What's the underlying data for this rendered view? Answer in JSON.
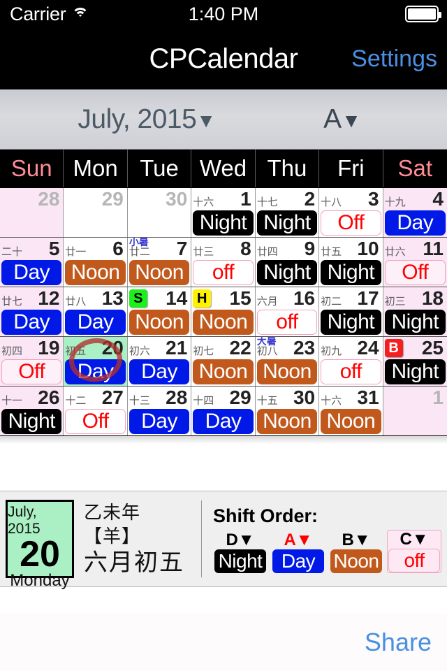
{
  "statusbar": {
    "carrier": "Carrier",
    "time": "1:40 PM",
    "wifi_icon": "wifi-icon",
    "battery_icon": "battery-full-icon"
  },
  "navbar": {
    "title": "CPCalendar",
    "settings": "Settings"
  },
  "toolbar": {
    "month": "July, 2015",
    "month_caret": "▼",
    "font_size": "A",
    "font_caret": "▼"
  },
  "weekdays": [
    {
      "label": "Sun",
      "weekend": true
    },
    {
      "label": "Mon",
      "weekend": false
    },
    {
      "label": "Tue",
      "weekend": false
    },
    {
      "label": "Wed",
      "weekend": false
    },
    {
      "label": "Thu",
      "weekend": false
    },
    {
      "label": "Fri",
      "weekend": false
    },
    {
      "label": "Sat",
      "weekend": true
    }
  ],
  "weeks": [
    [
      {
        "day": "28",
        "lunar": "",
        "term": "",
        "badge": "",
        "shift": "",
        "shift_class": "empty",
        "other": true,
        "weekend": true,
        "selected": false
      },
      {
        "day": "29",
        "lunar": "",
        "term": "",
        "badge": "",
        "shift": "",
        "shift_class": "empty",
        "other": true,
        "weekend": false,
        "selected": false
      },
      {
        "day": "30",
        "lunar": "",
        "term": "",
        "badge": "",
        "shift": "",
        "shift_class": "empty",
        "other": true,
        "weekend": false,
        "selected": false
      },
      {
        "day": "1",
        "lunar": "十六",
        "term": "",
        "badge": "",
        "shift": "Night",
        "shift_class": "night",
        "other": false,
        "weekend": false,
        "selected": false
      },
      {
        "day": "2",
        "lunar": "十七",
        "term": "",
        "badge": "",
        "shift": "Night",
        "shift_class": "night",
        "other": false,
        "weekend": false,
        "selected": false
      },
      {
        "day": "3",
        "lunar": "十八",
        "term": "",
        "badge": "",
        "shift": "Off",
        "shift_class": "off",
        "other": false,
        "weekend": false,
        "selected": false
      },
      {
        "day": "4",
        "lunar": "十九",
        "term": "",
        "badge": "",
        "shift": "Day",
        "shift_class": "day",
        "other": false,
        "weekend": true,
        "selected": false
      }
    ],
    [
      {
        "day": "5",
        "lunar": "二十",
        "term": "",
        "badge": "",
        "shift": "Day",
        "shift_class": "day",
        "other": false,
        "weekend": true,
        "selected": false
      },
      {
        "day": "6",
        "lunar": "廿一",
        "term": "",
        "badge": "",
        "shift": "Noon",
        "shift_class": "noon",
        "other": false,
        "weekend": false,
        "selected": false
      },
      {
        "day": "7",
        "lunar": "廿二",
        "term": "小暑",
        "badge": "",
        "shift": "Noon",
        "shift_class": "noon",
        "other": false,
        "weekend": false,
        "selected": false
      },
      {
        "day": "8",
        "lunar": "廿三",
        "term": "",
        "badge": "",
        "shift": "off",
        "shift_class": "off",
        "other": false,
        "weekend": false,
        "selected": false
      },
      {
        "day": "9",
        "lunar": "廿四",
        "term": "",
        "badge": "",
        "shift": "Night",
        "shift_class": "night",
        "other": false,
        "weekend": false,
        "selected": false
      },
      {
        "day": "10",
        "lunar": "廿五",
        "term": "",
        "badge": "",
        "shift": "Night",
        "shift_class": "night",
        "other": false,
        "weekend": false,
        "selected": false
      },
      {
        "day": "11",
        "lunar": "廿六",
        "term": "",
        "badge": "",
        "shift": "Off",
        "shift_class": "off",
        "other": false,
        "weekend": true,
        "selected": false
      }
    ],
    [
      {
        "day": "12",
        "lunar": "廿七",
        "term": "",
        "badge": "",
        "shift": "Day",
        "shift_class": "day",
        "other": false,
        "weekend": true,
        "selected": false
      },
      {
        "day": "13",
        "lunar": "廿八",
        "term": "",
        "badge": "",
        "shift": "Day",
        "shift_class": "day",
        "other": false,
        "weekend": false,
        "selected": false
      },
      {
        "day": "14",
        "lunar": "",
        "term": "",
        "badge": "S",
        "badge_class": "s",
        "shift": "Noon",
        "shift_class": "noon",
        "other": false,
        "weekend": false,
        "selected": false
      },
      {
        "day": "15",
        "lunar": "",
        "term": "",
        "badge": "H",
        "badge_class": "h",
        "shift": "Noon",
        "shift_class": "noon",
        "other": false,
        "weekend": false,
        "selected": false
      },
      {
        "day": "16",
        "lunar": "六月",
        "term": "",
        "badge": "",
        "shift": "off",
        "shift_class": "off",
        "other": false,
        "weekend": false,
        "selected": false
      },
      {
        "day": "17",
        "lunar": "初二",
        "term": "",
        "badge": "",
        "shift": "Night",
        "shift_class": "night",
        "other": false,
        "weekend": false,
        "selected": false
      },
      {
        "day": "18",
        "lunar": "初三",
        "term": "",
        "badge": "",
        "shift": "Night",
        "shift_class": "night",
        "other": false,
        "weekend": true,
        "selected": false
      }
    ],
    [
      {
        "day": "19",
        "lunar": "初四",
        "term": "",
        "badge": "",
        "shift": "Off",
        "shift_class": "off",
        "other": false,
        "weekend": true,
        "selected": false
      },
      {
        "day": "20",
        "lunar": "初五",
        "term": "",
        "badge": "",
        "shift": "Day",
        "shift_class": "day",
        "other": false,
        "weekend": false,
        "selected": true
      },
      {
        "day": "21",
        "lunar": "初六",
        "term": "",
        "badge": "",
        "shift": "Day",
        "shift_class": "day",
        "other": false,
        "weekend": false,
        "selected": false
      },
      {
        "day": "22",
        "lunar": "初七",
        "term": "",
        "badge": "",
        "shift": "Noon",
        "shift_class": "noon",
        "other": false,
        "weekend": false,
        "selected": false
      },
      {
        "day": "23",
        "lunar": "初八",
        "term": "大暑",
        "badge": "",
        "shift": "Noon",
        "shift_class": "noon",
        "other": false,
        "weekend": false,
        "selected": false
      },
      {
        "day": "24",
        "lunar": "初九",
        "term": "",
        "badge": "",
        "shift": "off",
        "shift_class": "off",
        "other": false,
        "weekend": false,
        "selected": false
      },
      {
        "day": "25",
        "lunar": "",
        "term": "",
        "badge": "B",
        "badge_class": "b",
        "shift": "Night",
        "shift_class": "night",
        "other": false,
        "weekend": true,
        "selected": false
      }
    ],
    [
      {
        "day": "26",
        "lunar": "十一",
        "term": "",
        "badge": "",
        "shift": "Night",
        "shift_class": "night",
        "other": false,
        "weekend": true,
        "selected": false
      },
      {
        "day": "27",
        "lunar": "十二",
        "term": "",
        "badge": "",
        "shift": "Off",
        "shift_class": "off",
        "other": false,
        "weekend": false,
        "selected": false
      },
      {
        "day": "28",
        "lunar": "十三",
        "term": "",
        "badge": "",
        "shift": "Day",
        "shift_class": "day",
        "other": false,
        "weekend": false,
        "selected": false
      },
      {
        "day": "29",
        "lunar": "十四",
        "term": "",
        "badge": "",
        "shift": "Day",
        "shift_class": "day",
        "other": false,
        "weekend": false,
        "selected": false
      },
      {
        "day": "30",
        "lunar": "十五",
        "term": "",
        "badge": "",
        "shift": "Noon",
        "shift_class": "noon",
        "other": false,
        "weekend": false,
        "selected": false
      },
      {
        "day": "31",
        "lunar": "十六",
        "term": "",
        "badge": "",
        "shift": "Noon",
        "shift_class": "noon",
        "other": false,
        "weekend": false,
        "selected": false
      },
      {
        "day": "1",
        "lunar": "",
        "term": "",
        "badge": "",
        "shift": "",
        "shift_class": "empty",
        "other": true,
        "weekend": true,
        "selected": false
      }
    ]
  ],
  "detail": {
    "month": "July, 2015",
    "day": "20",
    "weekday": "Monday",
    "lunar_year": "乙未年【羊】",
    "lunar_date": "六月初五"
  },
  "shift_order": {
    "title": "Shift Order:",
    "caret": "▼",
    "items": [
      {
        "letter": "D",
        "label": "Night",
        "cls": "night",
        "letter_red": false,
        "highlight": false
      },
      {
        "letter": "A",
        "label": "Day",
        "cls": "day",
        "letter_red": true,
        "highlight": false
      },
      {
        "letter": "B",
        "label": "Noon",
        "cls": "noon",
        "letter_red": false,
        "highlight": false
      },
      {
        "letter": "C",
        "label": "off",
        "cls": "off",
        "letter_red": false,
        "highlight": true
      }
    ]
  },
  "footer": {
    "share": "Share"
  },
  "colors": {
    "night": "#000000",
    "day": "#0019e6",
    "noon": "#c2591c",
    "off_text": "#ff0000",
    "weekend_bg": "#fbe6f6",
    "selected_bg": "#aaf0c4",
    "accent_blue": "#4a90e2",
    "term_blue": "#3b3bd0",
    "badge_s": "#1bf01b",
    "badge_h": "#fff200",
    "badge_b": "#f51f1f"
  }
}
